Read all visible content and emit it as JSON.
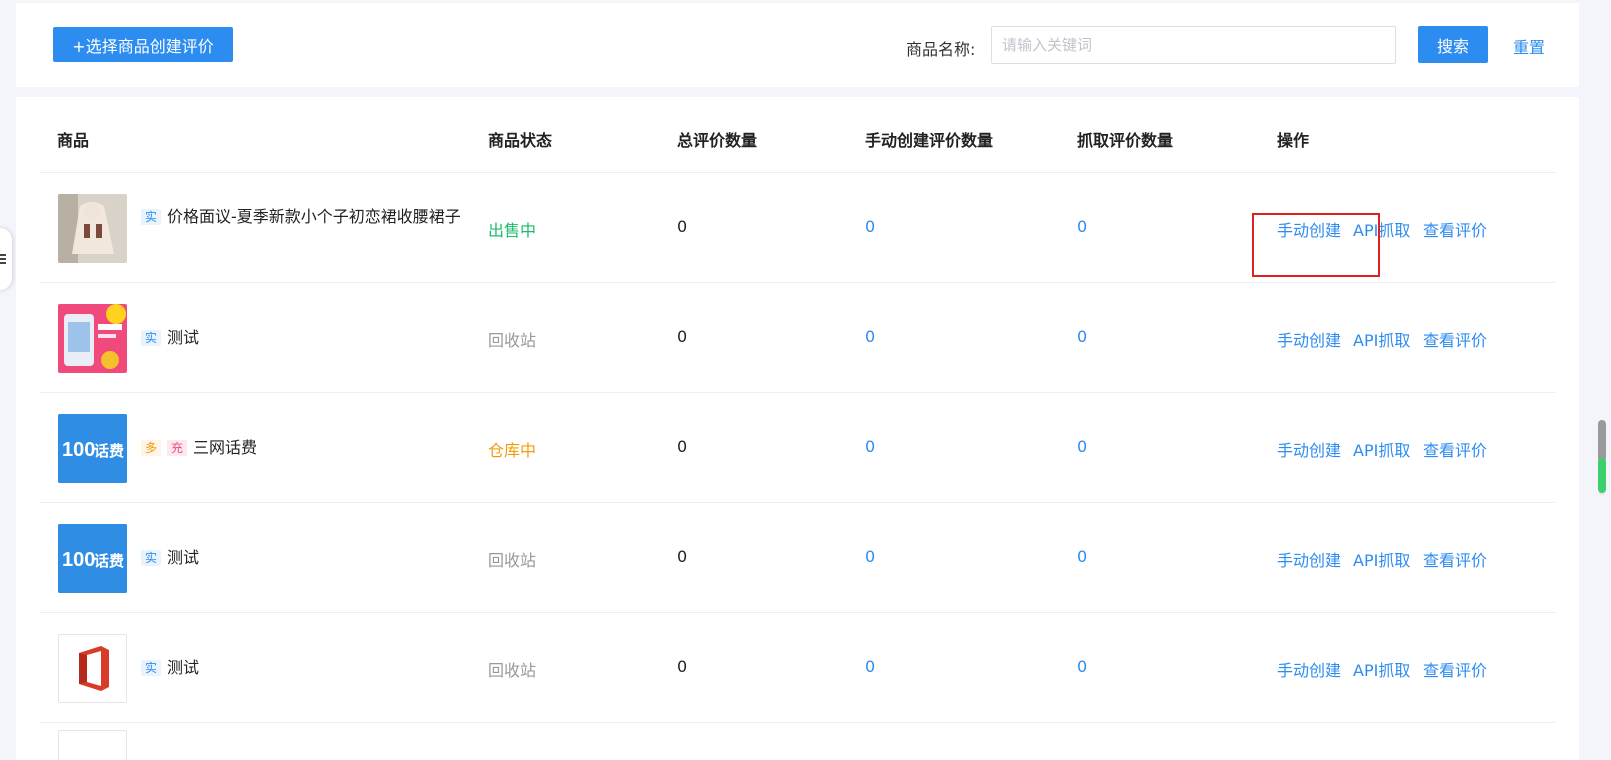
{
  "toolbar": {
    "create_label": "+选择商品创建评价",
    "search_label": "商品名称:",
    "search_placeholder": "请输入关键词",
    "search_value": "",
    "search_button": "搜索",
    "reset_link": "重置"
  },
  "table": {
    "headers": [
      "商品",
      "商品状态",
      "总评价数量",
      "手动创建评价数量",
      "抓取评价数量",
      "操作"
    ],
    "rows": [
      {
        "thumb": "dress-photo",
        "tags": [
          "实"
        ],
        "name": "价格面议-夏季新款小个子初恋裙收腰裙子",
        "status": "出售中",
        "total": "0",
        "manual": "0",
        "fetched": "0"
      },
      {
        "thumb": "pink-poster-photo",
        "tags": [
          "实"
        ],
        "name": "测试",
        "status": "回收站",
        "total": "0",
        "manual": "0",
        "fetched": "0"
      },
      {
        "thumb": "phone-credit-image",
        "thumb_text": "100",
        "thumb_text2": "话费",
        "tags": [
          "多",
          "充"
        ],
        "name": "三网话费",
        "status": "仓库中",
        "total": "0",
        "manual": "0",
        "fetched": "0"
      },
      {
        "thumb": "phone-credit-image",
        "thumb_text": "100",
        "thumb_text2": "话费",
        "tags": [
          "实"
        ],
        "name": "测试",
        "status": "回收站",
        "total": "0",
        "manual": "0",
        "fetched": "0"
      },
      {
        "thumb": "office-logo-image",
        "tags": [
          "实"
        ],
        "name": "测试",
        "status": "回收站",
        "total": "0",
        "manual": "0",
        "fetched": "0"
      }
    ],
    "actions": {
      "manual_create": "手动创建",
      "api_fetch": "API抓取",
      "view_reviews": "查看评价"
    }
  },
  "colors": {
    "accent": "#2d8cf0",
    "status_on_sale": "#19be6b",
    "status_in_warehouse": "#f29b0c",
    "status_recycle": "#999999",
    "highlight": "#e02020"
  }
}
